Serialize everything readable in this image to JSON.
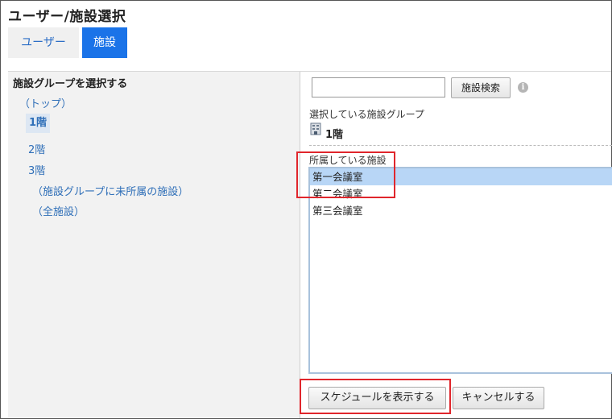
{
  "title": "ユーザー/施設選択",
  "tabs": {
    "user": "ユーザー",
    "facility": "施設"
  },
  "left": {
    "heading": "施設グループを選択する",
    "top_link": "（トップ）",
    "items": [
      "1階",
      "2階",
      "3階"
    ],
    "unassigned": "（施設グループに未所属の施設）",
    "all": "（全施設）"
  },
  "search": {
    "value": "",
    "button": "施設検索"
  },
  "selected_group": {
    "label": "選択している施設グループ",
    "value": "1階"
  },
  "members": {
    "label": "所属している施設",
    "items": [
      "第一会議室",
      "第二会議室",
      "第三会議室"
    ]
  },
  "buttons": {
    "show_schedule": "スケジュールを表示する",
    "cancel": "キャンセルする"
  },
  "colors": {
    "accent": "#1a73e8",
    "link": "#2f6fb8",
    "highlight": "#e0262c",
    "selection": "#b8d6f6"
  }
}
